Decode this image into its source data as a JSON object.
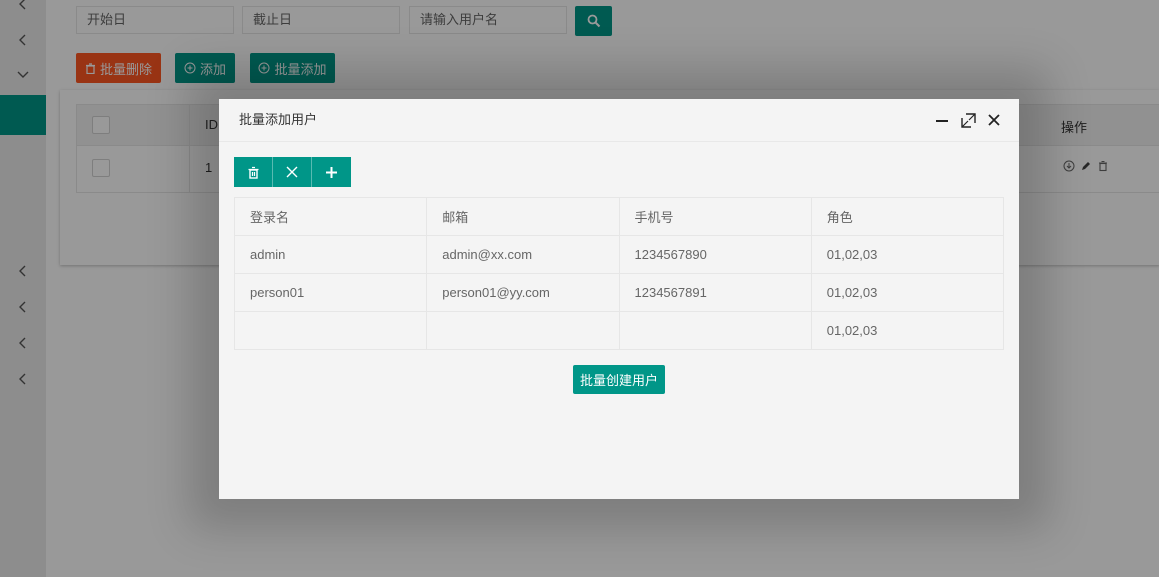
{
  "filters": {
    "start_date_placeholder": "开始日",
    "end_date_placeholder": "截止日",
    "username_placeholder": "请输入用户名"
  },
  "toolbar": {
    "batch_delete_label": "批量删除",
    "add_label": "添加",
    "batch_add_label": "批量添加"
  },
  "bg_table": {
    "headers": {
      "id": "ID",
      "actions": "操作"
    },
    "rows": [
      {
        "id": "1"
      }
    ]
  },
  "dialog": {
    "title": "批量添加用户",
    "columns": [
      "登录名",
      "邮箱",
      "手机号",
      "角色"
    ],
    "rows": [
      [
        "admin",
        "admin@xx.com",
        "1234567890",
        "01,02,03"
      ],
      [
        "person01",
        "person01@yy.com",
        "1234567891",
        "01,02,03"
      ],
      [
        "",
        "",
        "",
        "01,02,03"
      ]
    ],
    "create_button_label": "批量创建用户"
  },
  "colors": {
    "primary": "#009688",
    "danger": "#ff5722"
  }
}
